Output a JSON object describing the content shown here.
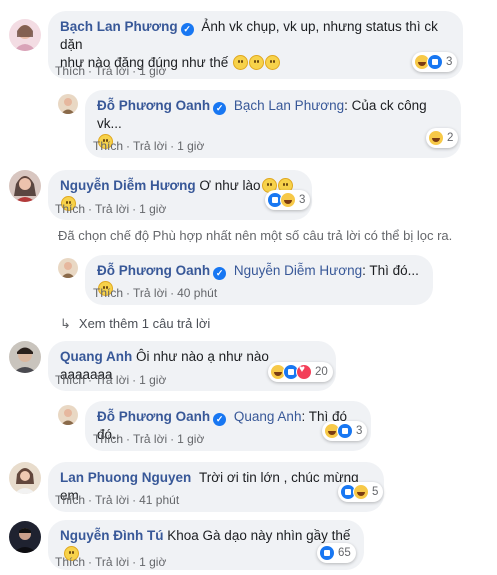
{
  "comments": [
    {
      "author": "Bạch Lan Phương",
      "text_line1": "Ảnh vk chụp, vk up, nhưng status thì ck dặn",
      "text_line2": "như nào đăng đúng như thế",
      "like_label": "Thích",
      "reply_label": "Trả lời",
      "time": "1 giờ",
      "reaction_count": "3"
    },
    {
      "author": "Đỗ Phương Oanh",
      "mention": "Bạch Lan Phương",
      "text": ": Của ck công vk...",
      "like_label": "Thích",
      "reply_label": "Trả lời",
      "time": "1 giờ",
      "reaction_count": "2"
    },
    {
      "author": "Nguyễn Diễm Hương",
      "text": "Ơ như lào",
      "like_label": "Thích",
      "reply_label": "Trả lời",
      "time": "1 giờ",
      "reaction_count": "3"
    },
    {
      "author": "Đỗ Phương Oanh",
      "mention": "Nguyễn Diễm Hương",
      "text": ": Thì đó...",
      "like_label": "Thích",
      "reply_label": "Trả lời",
      "time": "40 phút"
    },
    {
      "author": "Quang Anh",
      "text": "Ôi như nào ạ như nào aaaaaaa",
      "like_label": "Thích",
      "reply_label": "Trả lời",
      "time": "1 giờ",
      "reaction_count": "20"
    },
    {
      "author": "Đỗ Phương Oanh",
      "mention": "Quang Anh",
      "text": ": Thì đó đó..",
      "like_label": "Thích",
      "reply_label": "Trả lời",
      "time": "1 giờ",
      "reaction_count": "3"
    },
    {
      "author": "Lan Phuong Nguyen",
      "text": "Trời ơi tin lớn , chúc mừng em",
      "like_label": "Thích",
      "reply_label": "Trả lời",
      "time": "41 phút",
      "reaction_count": "5"
    },
    {
      "author": "Nguyễn Đình Tú",
      "text": "Khoa Gà dạo này nhìn gầy thế",
      "like_label": "Thích",
      "reply_label": "Trả lời",
      "time": "1 giờ",
      "reaction_count": "65"
    }
  ],
  "filter_notice": "Đã chọn chế độ Phù hợp nhất nên một số câu trả lời có thể bị lọc ra.",
  "see_more": "Xem thêm 1 câu trả lời",
  "colors": {
    "name": "#385898",
    "bubble": "#f0f2f5",
    "meta": "#65676b",
    "like": "#1877f2",
    "love": "#f33e58",
    "haha": "#f7c948"
  }
}
